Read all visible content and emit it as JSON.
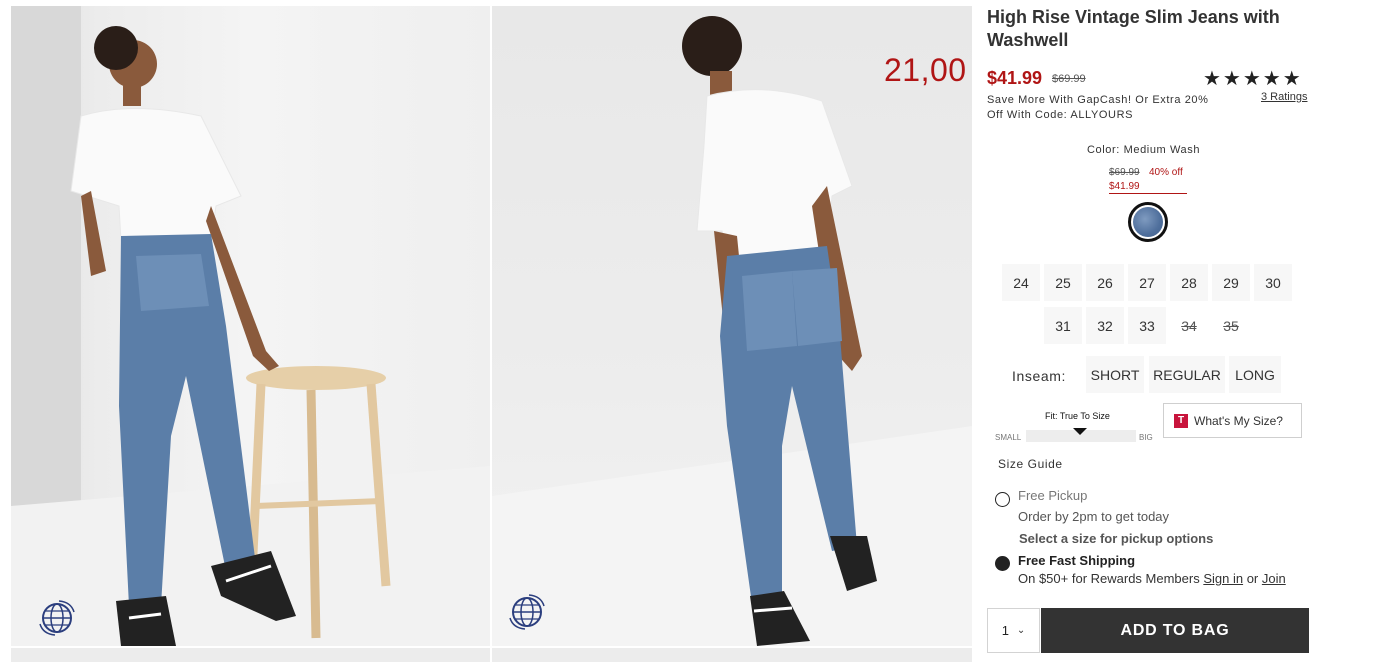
{
  "overlay": {
    "price_fragment": "21,00"
  },
  "product": {
    "title": "High Rise Vintage Slim Jeans with Washwell",
    "sale_price": "$41.99",
    "original_price": "$69.99",
    "rating_stars": "★★★★★",
    "rating_value": 5,
    "ratings_link": "3 Ratings",
    "promo": "Save More With GapCash! Or Extra 20% Off With Code: ALLYOURS"
  },
  "color": {
    "label": "Color: Medium Wash",
    "swatch_original_price": "$69.99",
    "swatch_discount": "40% off",
    "swatch_sale_price": "$41.99",
    "swatch_icon": "denim-swatch",
    "swatch_color": "#5a78a6"
  },
  "sizes": {
    "row1": [
      "24",
      "25",
      "26",
      "27",
      "28",
      "29",
      "30"
    ],
    "row2": [
      "31",
      "32",
      "33",
      "34",
      "35"
    ],
    "unavailable": [
      "34",
      "35"
    ]
  },
  "inseam": {
    "label": "Inseam:",
    "options": [
      "SHORT",
      "REGULAR",
      "LONG"
    ]
  },
  "fit": {
    "title": "Fit: True To Size",
    "small_label": "SMALL",
    "big_label": "BIG"
  },
  "whats_my_size": {
    "label": "What's My Size?",
    "logo_letter": "T",
    "logo_color": "#c8143c"
  },
  "size_guide": "Size Guide",
  "fulfillment": {
    "pickup_title": "Free Pickup",
    "pickup_subtitle": "Order by 2pm to get today",
    "pickup_note": "Select a size for pickup options",
    "shipping_title": "Free Fast Shipping",
    "shipping_subtitle_prefix": "On $50+ for Rewards Members ",
    "sign_in": "Sign in",
    "or": " or ",
    "join": "Join",
    "selected": "shipping"
  },
  "cart": {
    "quantity": "1",
    "add_to_bag": "ADD TO BAG"
  },
  "icons": {
    "image_badge": "globe-360-icon",
    "dropdown": "chevron-down-icon"
  },
  "colors": {
    "sale_red": "#b01515",
    "button_dark": "#333333"
  }
}
